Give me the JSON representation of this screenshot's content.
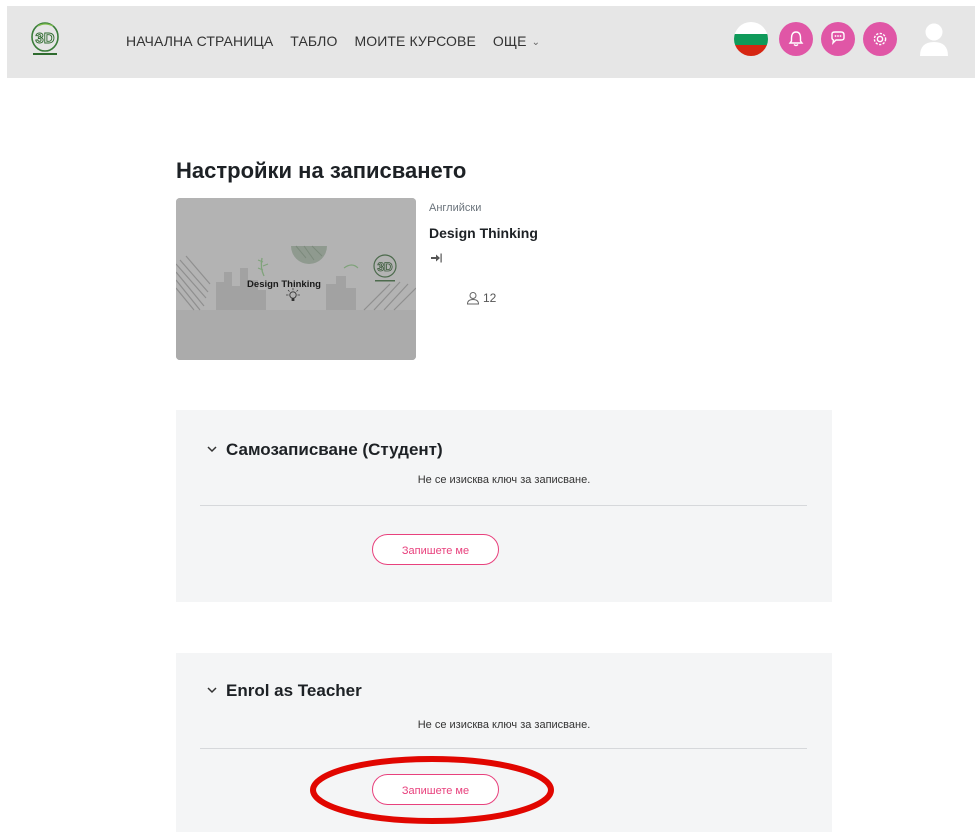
{
  "navbar": {
    "links": [
      "НАЧАЛНА СТРАНИЦА",
      "ТАБЛО",
      "МОИТЕ КУРСОВЕ",
      "ОЩЕ"
    ],
    "icons": [
      "bulgaria-flag-icon",
      "bell-icon",
      "chat-icon",
      "gear-icon",
      "user-avatar-icon"
    ],
    "accent_color": "#e056a6"
  },
  "page": {
    "title": "Настройки на записването"
  },
  "course": {
    "category": "Английски",
    "name": "Design Thinking",
    "participants": "12",
    "image_text": "Design Thinking"
  },
  "methods": [
    {
      "title": "Самозаписване (Студент)",
      "note": "Не се изисква ключ за записване.",
      "button": "Запишете ме"
    },
    {
      "title": "Enrol as Teacher",
      "note": "Не се изисква ключ за записване.",
      "button": "Запишете ме"
    }
  ],
  "colors": {
    "button_accent": "#e8417d",
    "annotation": "#e10600"
  }
}
